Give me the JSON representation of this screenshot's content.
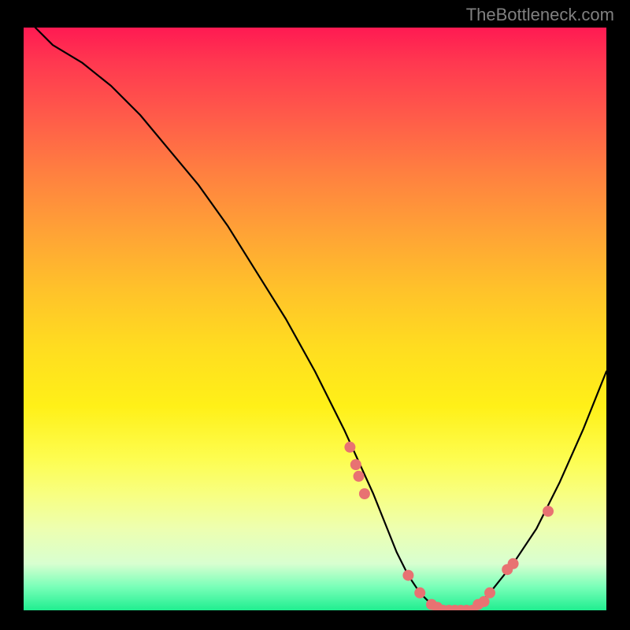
{
  "watermark": "TheBottleneck.com",
  "chart_data": {
    "type": "line",
    "title": "",
    "xlabel": "",
    "ylabel": "",
    "xlim": [
      0,
      100
    ],
    "ylim": [
      0,
      100
    ],
    "series": [
      {
        "name": "curve",
        "type": "line",
        "x": [
          2,
          5,
          10,
          15,
          20,
          25,
          30,
          35,
          40,
          45,
          50,
          55,
          60,
          62,
          64,
          66,
          68,
          70,
          72,
          74,
          76,
          78,
          80,
          84,
          88,
          92,
          96,
          100
        ],
        "values": [
          100,
          97,
          94,
          90,
          85,
          79,
          73,
          66,
          58,
          50,
          41,
          31,
          20,
          15,
          10,
          6,
          3,
          1,
          0,
          0,
          0,
          1,
          3,
          8,
          14,
          22,
          31,
          41
        ]
      },
      {
        "name": "markers",
        "type": "scatter",
        "x": [
          56,
          57,
          57.5,
          58.5,
          66,
          68,
          70,
          71,
          72,
          73,
          74,
          75,
          76,
          77,
          78,
          79,
          80,
          83,
          84,
          90
        ],
        "values": [
          28,
          25,
          23,
          20,
          6,
          3,
          1,
          0.5,
          0,
          0,
          0,
          0,
          0,
          0,
          1,
          1.5,
          3,
          7,
          8,
          17
        ]
      }
    ]
  }
}
